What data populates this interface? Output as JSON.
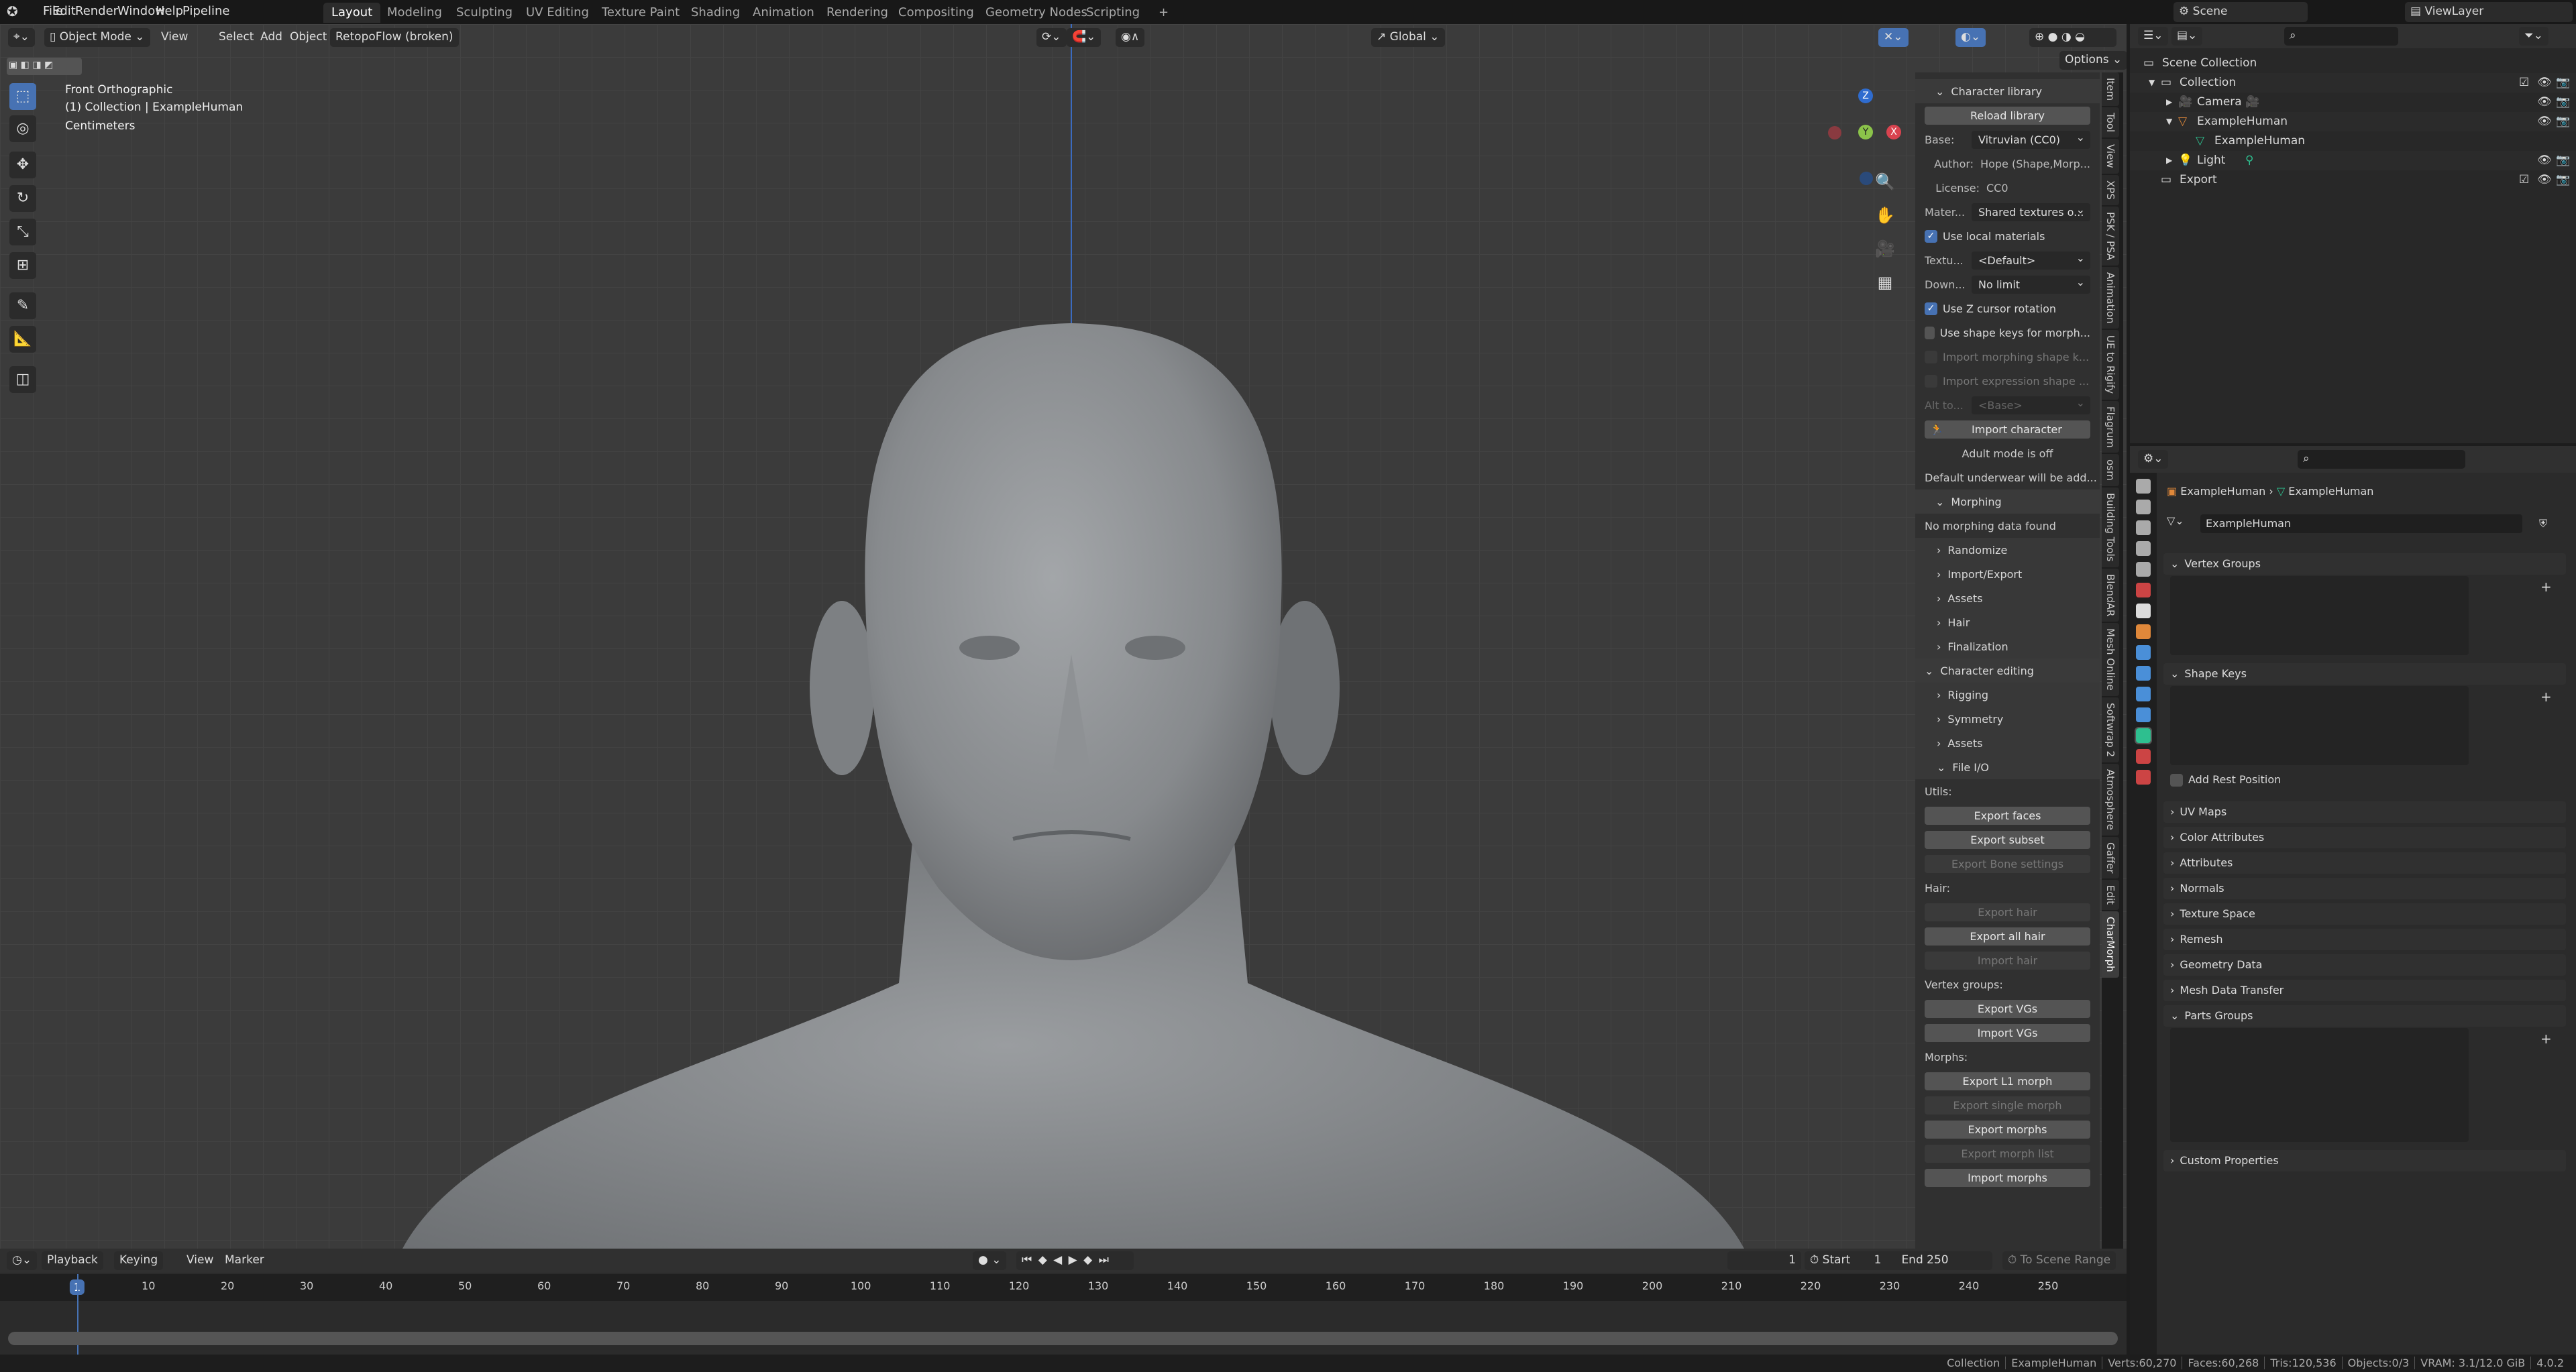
{
  "topbar": {
    "menus": [
      "File",
      "Edit",
      "Render",
      "Window",
      "Help",
      "Pipeline"
    ],
    "workspaces": [
      "Layout",
      "Modeling",
      "Sculpting",
      "UV Editing",
      "Texture Paint",
      "Shading",
      "Animation",
      "Rendering",
      "Compositing",
      "Geometry Nodes",
      "Scripting",
      "+"
    ],
    "active_workspace": "Layout",
    "scene": "Scene",
    "view_layer": "ViewLayer"
  },
  "viewport": {
    "mode": "Object Mode",
    "menus": [
      "View",
      "Select",
      "Add",
      "Object"
    ],
    "addon_menu": "RetopoFlow (broken)",
    "transform_orientation": "Global",
    "options_label": "Options",
    "overlay": {
      "view_name": "Front Orthographic",
      "collection": "(1) Collection | ExampleHuman",
      "units": "Centimeters"
    },
    "gizmo": {
      "x": "X",
      "y": "Y",
      "z": "Z"
    }
  },
  "npanel": {
    "tabs": [
      "Item",
      "Tool",
      "View",
      "XPS",
      "PSK / PSA",
      "Animation",
      "UE to Rigify",
      "Flagrum",
      "osm",
      "Building Tools",
      "BlendAR",
      "Mesh Online",
      "Softwrap 2",
      "Atmosphere",
      "Gaffer",
      "Edit",
      "CharMorph"
    ],
    "active_tab": "CharMorph",
    "rows": [
      {
        "type": "header",
        "text": "Character library",
        "open": true
      },
      {
        "type": "button",
        "text": "Reload library"
      },
      {
        "type": "select",
        "label": "Base:",
        "value": "Vitruvian (CC0)"
      },
      {
        "type": "info",
        "label": "Author:",
        "value": "Hope (Shape,Morp..."
      },
      {
        "type": "info",
        "label": "License:",
        "value": "CC0"
      },
      {
        "type": "select",
        "label": "Mater...",
        "value": "Shared textures o..."
      },
      {
        "type": "check",
        "text": "Use local materials",
        "checked": true
      },
      {
        "type": "select",
        "label": "Textu...",
        "value": "<Default>"
      },
      {
        "type": "select",
        "label": "Down...",
        "value": "No limit"
      },
      {
        "type": "check",
        "text": "Use Z cursor rotation",
        "checked": true
      },
      {
        "type": "check",
        "text": "Use shape keys for morph...",
        "checked": false
      },
      {
        "type": "check",
        "text": "Import morphing shape k...",
        "checked": false,
        "disabled": true
      },
      {
        "type": "check",
        "text": "Import expression shape ...",
        "checked": false,
        "disabled": true
      },
      {
        "type": "select",
        "label": "Alt to...",
        "value": "<Base>",
        "disabled": true
      },
      {
        "type": "button",
        "text": "Import character",
        "icon": "running-figure-icon"
      },
      {
        "type": "center",
        "text": "Adult mode is off"
      },
      {
        "type": "text",
        "text": "Default underwear will be add..."
      },
      {
        "type": "header",
        "text": "Morphing",
        "open": true
      },
      {
        "type": "text",
        "text": "No morphing data found"
      },
      {
        "type": "sub",
        "text": "Randomize"
      },
      {
        "type": "sub",
        "text": "Import/Export"
      },
      {
        "type": "sub",
        "text": "Assets"
      },
      {
        "type": "sub",
        "text": "Hair"
      },
      {
        "type": "sub",
        "text": "Finalization"
      },
      {
        "type": "header",
        "text": "Character editing",
        "open": true
      },
      {
        "type": "sub",
        "text": "Rigging"
      },
      {
        "type": "sub",
        "text": "Symmetry"
      },
      {
        "type": "sub",
        "text": "Assets"
      },
      {
        "type": "subopen",
        "text": "File I/O"
      },
      {
        "type": "text",
        "text": "Utils:"
      },
      {
        "type": "button",
        "text": "Export faces"
      },
      {
        "type": "button",
        "text": "Export subset"
      },
      {
        "type": "button",
        "text": "Export Bone settings",
        "disabled": true
      },
      {
        "type": "text",
        "text": "Hair:"
      },
      {
        "type": "button",
        "text": "Export hair",
        "disabled": true
      },
      {
        "type": "button",
        "text": "Export all hair"
      },
      {
        "type": "button",
        "text": "Import hair",
        "disabled": true
      },
      {
        "type": "text",
        "text": "Vertex groups:"
      },
      {
        "type": "button",
        "text": "Export VGs"
      },
      {
        "type": "button",
        "text": "Import VGs"
      },
      {
        "type": "text",
        "text": "Morphs:"
      },
      {
        "type": "button",
        "text": "Export L1 morph"
      },
      {
        "type": "button",
        "text": "Export single morph",
        "disabled": true
      },
      {
        "type": "button",
        "text": "Export morphs"
      },
      {
        "type": "button",
        "text": "Export morph list",
        "disabled": true
      },
      {
        "type": "button",
        "text": "Import morphs"
      }
    ]
  },
  "outliner": {
    "rows": [
      {
        "name": "Scene Collection",
        "icon": "collection-icon",
        "depth": 0
      },
      {
        "name": "Collection",
        "icon": "collection-icon",
        "depth": 1,
        "expanded": true,
        "checkbox": true
      },
      {
        "name": "Camera",
        "icon": "camera-icon",
        "depth": 2,
        "expanded": false,
        "data_icon": "camera-data-icon"
      },
      {
        "name": "ExampleHuman",
        "icon": "mesh-object-icon",
        "depth": 2,
        "expanded": true
      },
      {
        "name": "ExampleHuman",
        "icon": "mesh-data-icon",
        "depth": 3
      },
      {
        "name": "Light",
        "icon": "light-icon",
        "depth": 2,
        "expanded": false,
        "data_icon": "light-data-icon"
      },
      {
        "name": "Export",
        "icon": "collection-icon",
        "depth": 1,
        "checkbox": true
      }
    ]
  },
  "properties": {
    "breadcrumb": [
      "ExampleHuman",
      "ExampleHuman"
    ],
    "data_name": "ExampleHuman",
    "sections": [
      {
        "name": "Vertex Groups",
        "open": true
      },
      {
        "name": "Shape Keys",
        "open": true
      },
      {
        "name": "UV Maps"
      },
      {
        "name": "Color Attributes"
      },
      {
        "name": "Attributes"
      },
      {
        "name": "Normals"
      },
      {
        "name": "Texture Space"
      },
      {
        "name": "Remesh"
      },
      {
        "name": "Geometry Data"
      },
      {
        "name": "Mesh Data Transfer"
      },
      {
        "name": "Parts Groups",
        "open": true
      },
      {
        "name": "Custom Properties"
      }
    ],
    "add_rest_position": "Add Rest Position"
  },
  "timeline": {
    "menus": [
      "Playback",
      "Keying",
      "View",
      "Marker"
    ],
    "current_frame": "1",
    "start_label": "Start",
    "start": "1",
    "end_label": "End",
    "end": "250",
    "scene_range": "To Scene Range",
    "ticks": [
      "1",
      "10",
      "20",
      "30",
      "40",
      "50",
      "60",
      "70",
      "80",
      "90",
      "100",
      "110",
      "120",
      "130",
      "140",
      "150",
      "160",
      "170",
      "180",
      "190",
      "200",
      "210",
      "220",
      "230",
      "240",
      "250"
    ]
  },
  "status": {
    "items": [
      "Collection",
      "ExampleHuman",
      "Verts:60,270",
      "Faces:60,268",
      "Tris:120,536",
      "Objects:0/3",
      "VRAM: 3.1/12.0 GiB",
      "4.0.2"
    ]
  },
  "colors": {
    "accent": "#4772b3",
    "object_orange": "#e0883a",
    "data_green": "#2ebf8f"
  }
}
